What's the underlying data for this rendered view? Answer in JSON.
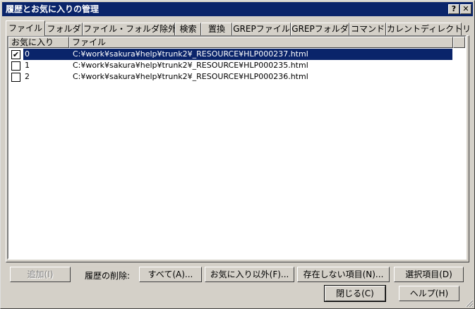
{
  "window": {
    "title": "履歴とお気に入りの管理",
    "help_button": "?",
    "close_button": "✕"
  },
  "tabs": [
    {
      "label": "ファイル"
    },
    {
      "label": "フォルダ"
    },
    {
      "label": "ファイル・フォルダ除外"
    },
    {
      "label": "検索"
    },
    {
      "label": "置換"
    },
    {
      "label": "GREPファイル"
    },
    {
      "label": "GREPフォルダ"
    },
    {
      "label": "コマンド"
    },
    {
      "label": "カレントディレクトリ"
    }
  ],
  "list": {
    "columns": {
      "favorite": "お気に入り",
      "file": "ファイル"
    },
    "rows": [
      {
        "checked": true,
        "num": "0",
        "file": "C:¥work¥sakura¥help¥trunk2¥_RESOURCE¥HLP000237.html",
        "selected": true
      },
      {
        "checked": false,
        "num": "1",
        "file": "C:¥work¥sakura¥help¥trunk2¥_RESOURCE¥HLP000235.html",
        "selected": false
      },
      {
        "checked": false,
        "num": "2",
        "file": "C:¥work¥sakura¥help¥trunk2¥_RESOURCE¥HLP000236.html",
        "selected": false
      }
    ]
  },
  "buttons": {
    "add": "追加(I)",
    "delete_label": "履歴の削除:",
    "all": "すべて(A)...",
    "non_favorites": "お気に入り以外(F)...",
    "nonexistent": "存在しない項目(N)...",
    "selected": "選択項目(D)",
    "close": "閉じる(C)",
    "help": "ヘルプ(H)"
  },
  "icons": {
    "check": "✔"
  }
}
